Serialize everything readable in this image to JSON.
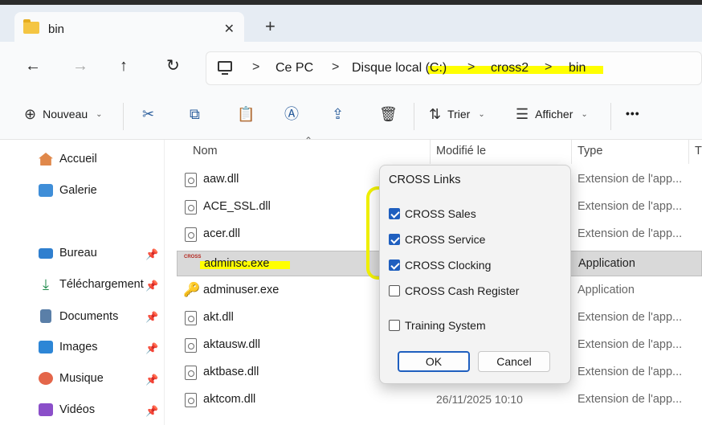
{
  "tab": {
    "title": "bin",
    "close_glyph": "✕",
    "new_glyph": "+"
  },
  "nav": {
    "back": "←",
    "forward": "→",
    "up": "↑",
    "refresh": "↻"
  },
  "breadcrumb": {
    "items": [
      "Ce PC",
      "Disque local (C:)",
      "cross2",
      "bin"
    ],
    "separator": ">"
  },
  "toolbar": {
    "new_label": "Nouveau",
    "sort_label": "Trier",
    "view_label": "Afficher",
    "more_glyph": "•••"
  },
  "sidebar": {
    "items": [
      {
        "label": "Accueil",
        "icon": "home-icon",
        "pinned": false
      },
      {
        "label": "Galerie",
        "icon": "gallery-icon",
        "pinned": false
      },
      {
        "label": "Bureau",
        "icon": "desktop-icon",
        "pinned": true
      },
      {
        "label": "Téléchargement",
        "icon": "download-icon",
        "pinned": true
      },
      {
        "label": "Documents",
        "icon": "documents-icon",
        "pinned": true
      },
      {
        "label": "Images",
        "icon": "images-icon",
        "pinned": true
      },
      {
        "label": "Musique",
        "icon": "music-icon",
        "pinned": true
      },
      {
        "label": "Vidéos",
        "icon": "videos-icon",
        "pinned": true
      }
    ]
  },
  "filelist": {
    "columns": {
      "name": "Nom",
      "modified": "Modifié le",
      "type": "Type",
      "extra": "T"
    },
    "rows": [
      {
        "name": "aaw.dll",
        "modified": "",
        "type": "Extension de l'app..."
      },
      {
        "name": "ACE_SSL.dll",
        "modified": "",
        "type": "Extension de l'app..."
      },
      {
        "name": "acer.dll",
        "modified": "",
        "type": "Extension de l'app..."
      },
      {
        "name": "adminsc.exe",
        "modified": "",
        "type": "Application",
        "selected": true
      },
      {
        "name": "adminuser.exe",
        "modified": "",
        "type": "Application"
      },
      {
        "name": "akt.dll",
        "modified": "",
        "type": "Extension de l'app..."
      },
      {
        "name": "aktausw.dll",
        "modified": "",
        "type": "Extension de l'app..."
      },
      {
        "name": "aktbase.dll",
        "modified": "",
        "type": "Extension de l'app..."
      },
      {
        "name": "aktcom.dll",
        "modified": "26/11/2025 10:10",
        "type": "Extension de l'app..."
      }
    ]
  },
  "dialog": {
    "title": "CROSS Links",
    "options": [
      {
        "label": "CROSS Sales",
        "checked": true
      },
      {
        "label": "CROSS Service",
        "checked": true
      },
      {
        "label": "CROSS Clocking",
        "checked": true
      },
      {
        "label": "CROSS Cash Register",
        "checked": false
      },
      {
        "label": "Training System",
        "checked": false
      }
    ],
    "ok_label": "OK",
    "cancel_label": "Cancel"
  },
  "colors": {
    "accent": "#1f5fbf",
    "highlight": "#ffff00"
  }
}
